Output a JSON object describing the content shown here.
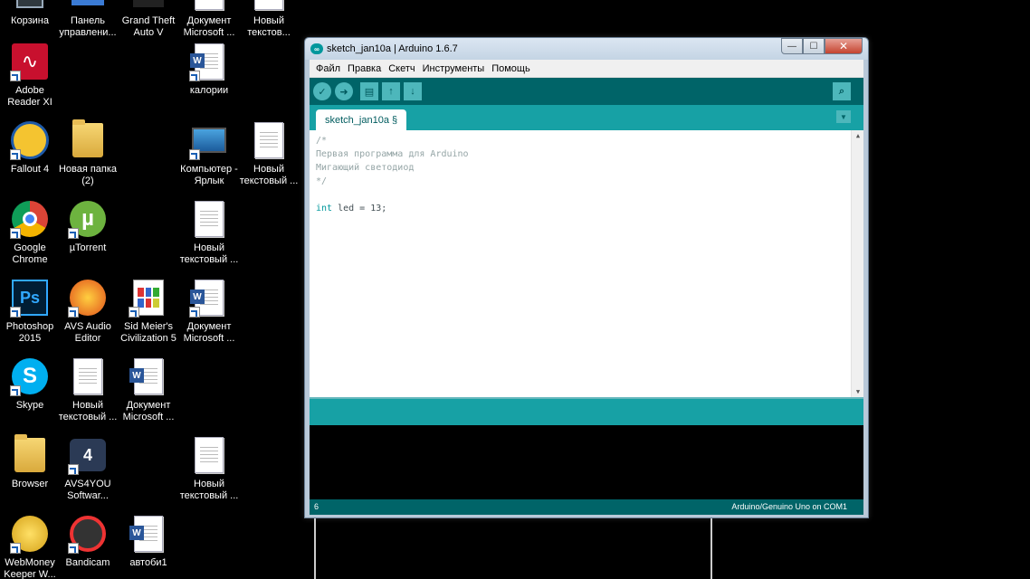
{
  "desktop": {
    "icons": [
      {
        "label": "Корзина"
      },
      {
        "label": "Панель управлени..."
      },
      {
        "label": "Grand Theft Auto V"
      },
      {
        "label": "Документ Microsoft ..."
      },
      {
        "label": "Новый текстов..."
      },
      {
        "label": "Adobe Reader XI"
      },
      {
        "label": "калории"
      },
      {
        "label": "Fallout 4"
      },
      {
        "label": "Новая папка (2)"
      },
      {
        "label": "Компьютер - Ярлык"
      },
      {
        "label": "Новый текстовый ..."
      },
      {
        "label": "Google Chrome"
      },
      {
        "label": "µTorrent"
      },
      {
        "label": "Новый текстовый ..."
      },
      {
        "label": "Photoshop 2015"
      },
      {
        "label": "AVS Audio Editor"
      },
      {
        "label": "Sid Meier's Civilization 5"
      },
      {
        "label": "Документ Microsoft ..."
      },
      {
        "label": "Skype"
      },
      {
        "label": "Новый текстовый ..."
      },
      {
        "label": "Документ Microsoft ..."
      },
      {
        "label": "Browser"
      },
      {
        "label": "AVS4YOU Softwar..."
      },
      {
        "label": "Новый текстовый ..."
      },
      {
        "label": "WebMoney Keeper W..."
      },
      {
        "label": "Bandicam"
      },
      {
        "label": "автоби1"
      }
    ],
    "icon_glyphs": {
      "ps": "Ps",
      "word": "W",
      "avs4you": "4"
    }
  },
  "window": {
    "title": "sketch_jan10a | Arduino 1.6.7",
    "logo": "∞",
    "controls": {
      "minimize": "—",
      "maximize": "☐",
      "close": "✕"
    },
    "menu": [
      "Файл",
      "Правка",
      "Скетч",
      "Инструменты",
      "Помощь"
    ],
    "toolbar": {
      "verify": "✓",
      "upload": "➜",
      "new": "▤",
      "open": "↑",
      "save": "↓",
      "serial_monitor": "⌕"
    },
    "tab": {
      "label": "sketch_jan10a §",
      "menu": "▼"
    },
    "code": [
      "/*",
      "Первая программа для Arduino",
      "Мигающий светодиод",
      "*/",
      "",
      {
        "kw": "int",
        "rest": " led = 13;"
      }
    ],
    "scroll": {
      "up": "▲",
      "down": "▼"
    },
    "status": {
      "line": "6",
      "board": "Arduino/Genuino Uno on COM1"
    }
  }
}
